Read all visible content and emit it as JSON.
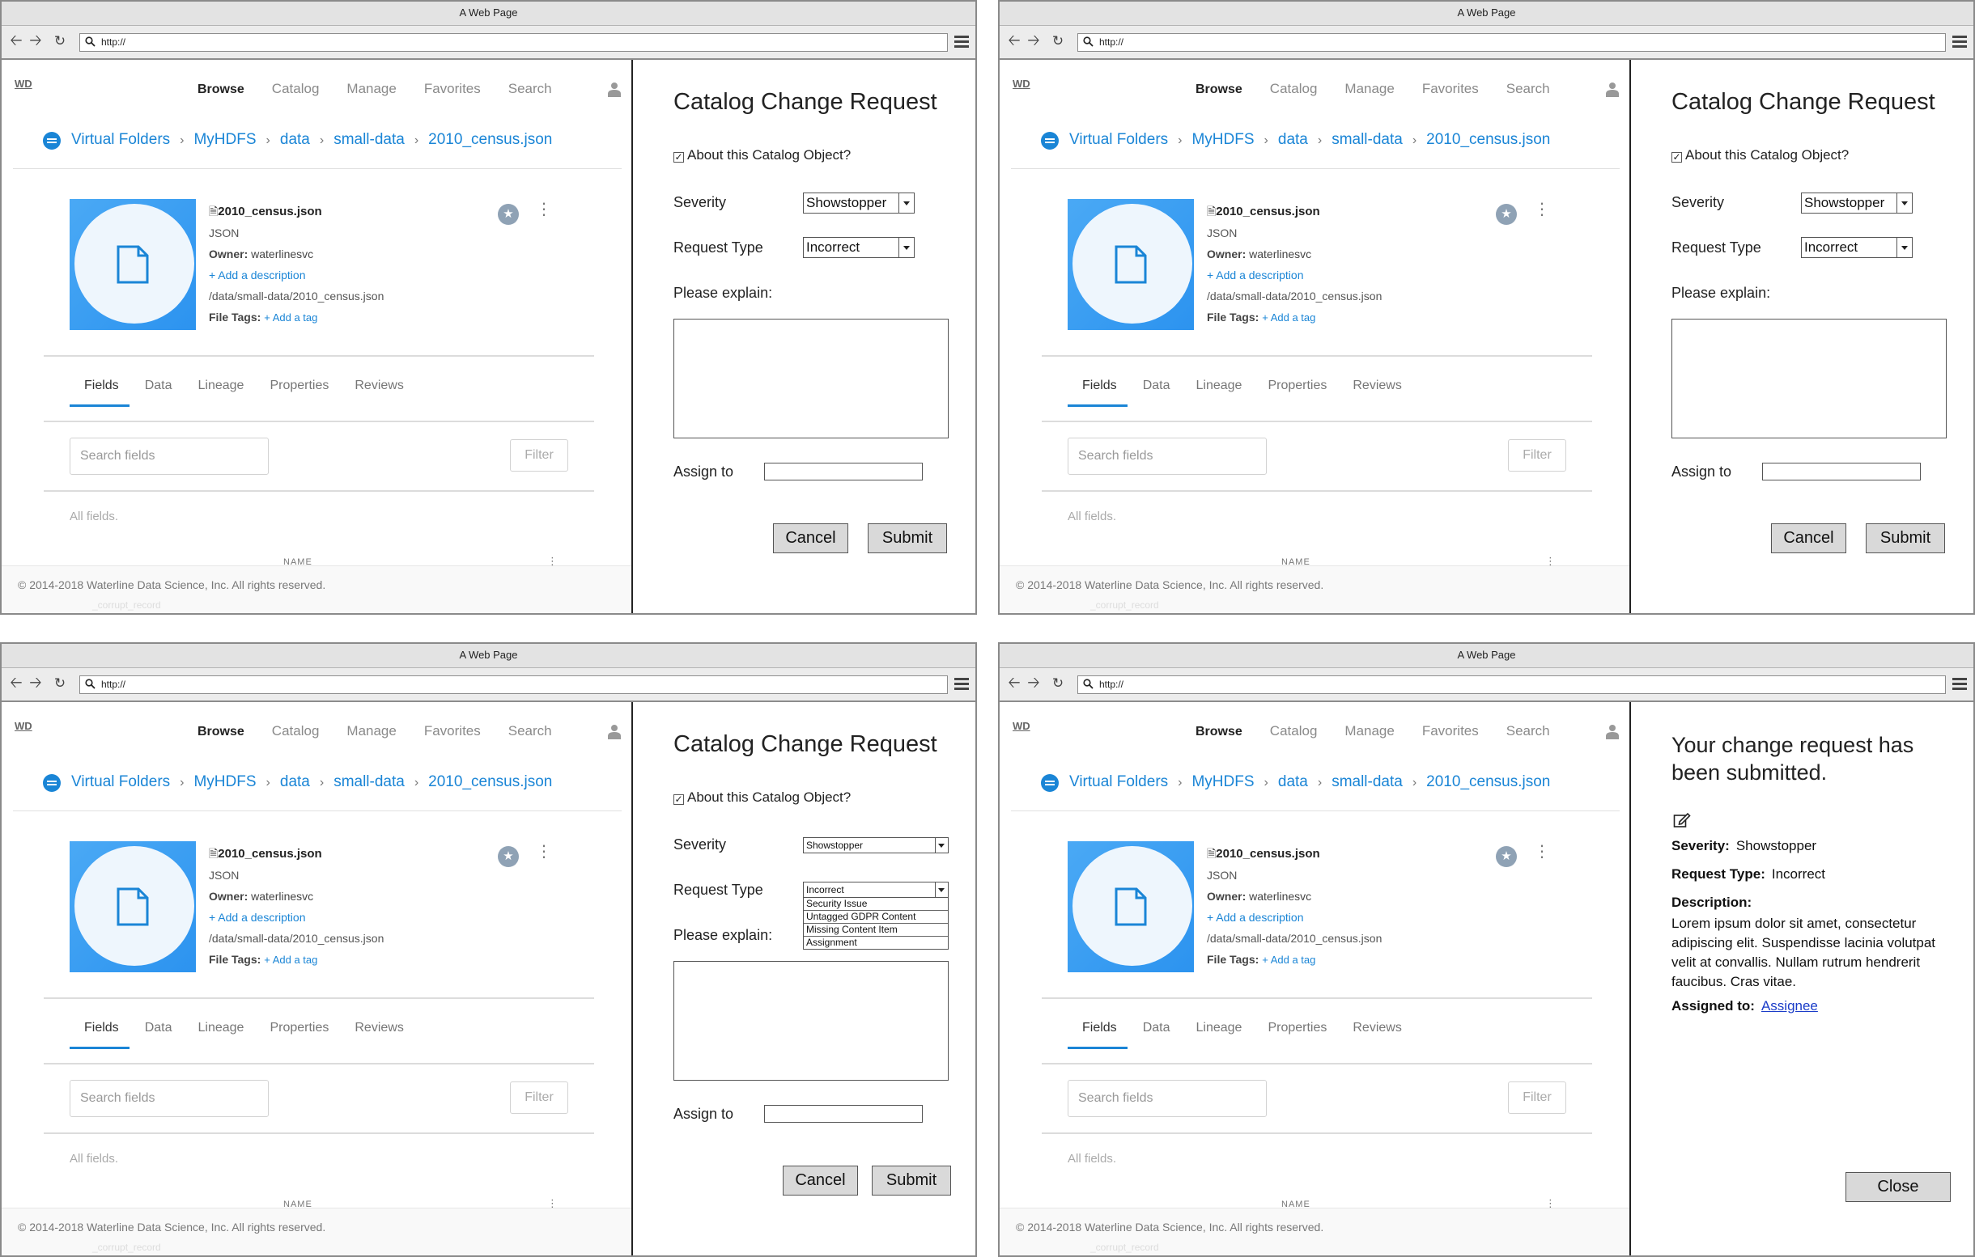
{
  "browser": {
    "window_title": "A Web Page",
    "url": "http://"
  },
  "app": {
    "logo": "WD",
    "nav": [
      "Browse",
      "Catalog",
      "Manage",
      "Favorites",
      "Search"
    ],
    "breadcrumb": [
      "Virtual Folders",
      "MyHDFS",
      "data",
      "small-data",
      "2010_census.json"
    ],
    "file": {
      "name": "2010_census.json",
      "type": "JSON",
      "owner_label": "Owner:",
      "owner": "waterlinesvc",
      "add_description": "Add a description",
      "path": "/data/small-data/2010_census.json",
      "tags_label": "File Tags:",
      "add_tag": "Add a tag"
    },
    "tabs": [
      "Fields",
      "Data",
      "Lineage",
      "Properties",
      "Reviews"
    ],
    "search_placeholder": "Search fields",
    "filter_label": "Filter",
    "all_fields": "All fields.",
    "column_name": "NAME",
    "footer": "© 2014-2018 Waterline Data Science, Inc. All rights reserved.",
    "footer_ghost": "_corrupt_record"
  },
  "form": {
    "title": "Catalog Change Request",
    "checkbox_label": "About this Catalog Object?",
    "severity_label": "Severity",
    "severity_value": "Showstopper",
    "request_type_label": "Request Type",
    "request_type_value": "Incorrect",
    "request_type_options": [
      "Security Issue",
      "Untagged GDPR Content",
      "Missing Content Item",
      "Assignment"
    ],
    "explain_label": "Please explain:",
    "assign_label": "Assign to",
    "cancel": "Cancel",
    "submit": "Submit"
  },
  "confirmation": {
    "title": "Your change request has been submitted.",
    "severity_label": "Severity:",
    "severity_value": "Showstopper",
    "request_type_label": "Request Type:",
    "request_type_value": "Incorrect",
    "description_label": "Description:",
    "description": "Lorem ipsum dolor sit amet, consectetur adipiscing elit. Suspendisse lacinia volutpat velit at convallis. Nullam rutrum hendrerit faucibus. Cras vitae.",
    "assigned_label": "Assigned to:",
    "assignee": "Assignee",
    "close": "Close"
  }
}
